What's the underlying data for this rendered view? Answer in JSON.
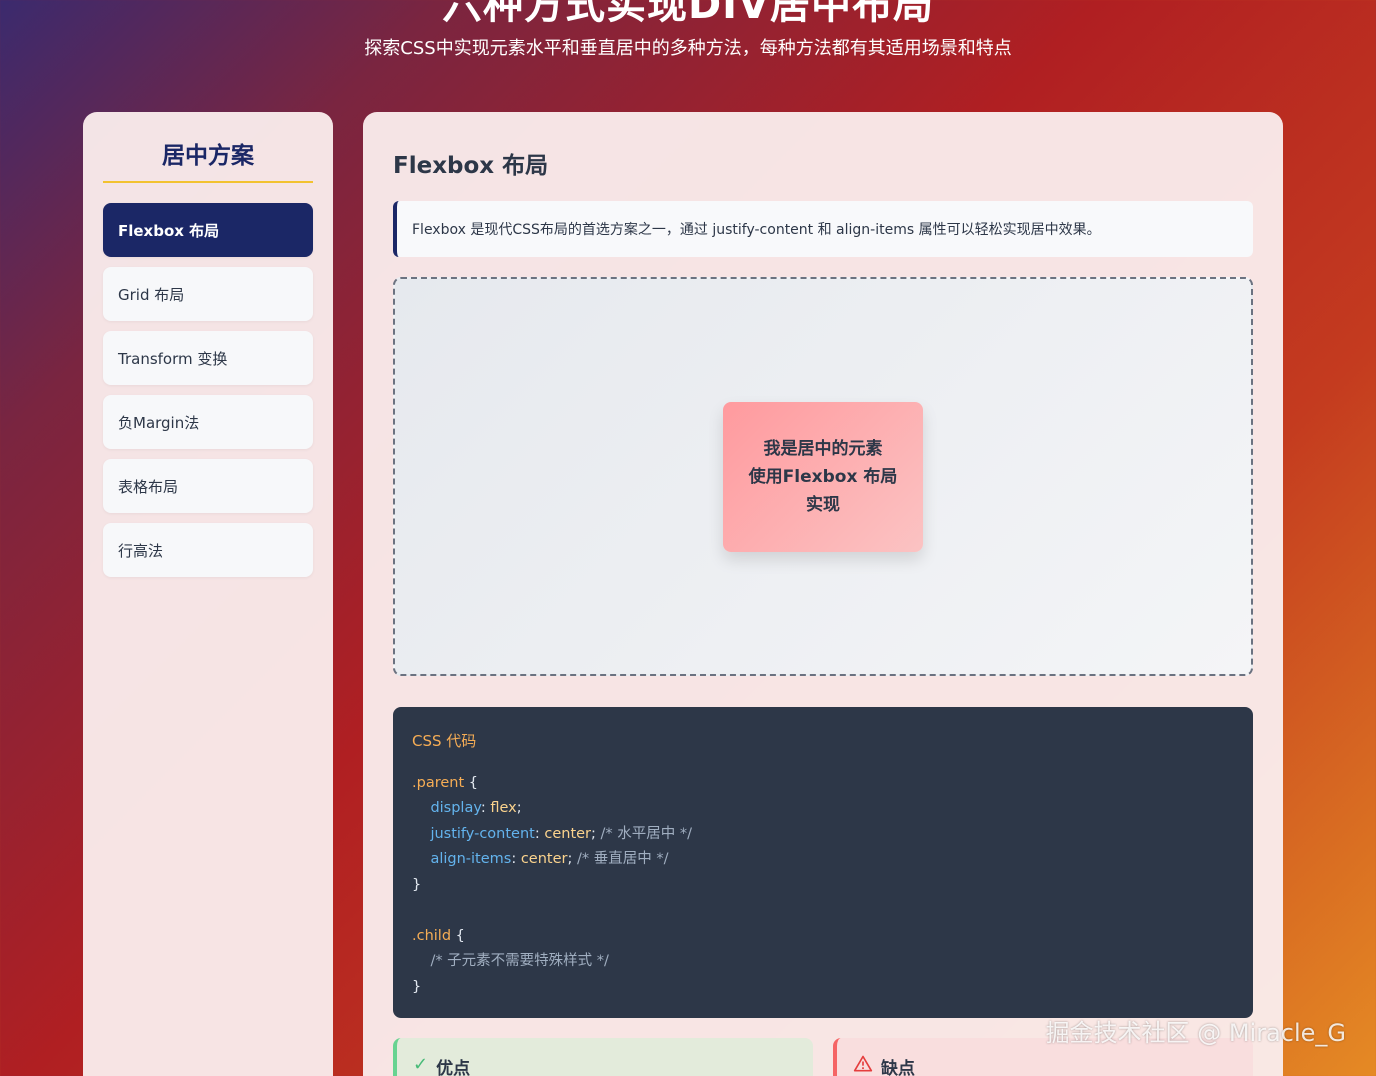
{
  "hero": {
    "title": "六种方式实现DIV居中布局",
    "subtitle": "探索CSS中实现元素水平和垂直居中的多种方法，每种方法都有其适用场景和特点"
  },
  "sidebar": {
    "title": "居中方案",
    "items": [
      {
        "label": "Flexbox 布局",
        "active": true
      },
      {
        "label": "Grid 布局"
      },
      {
        "label": "Transform 变换"
      },
      {
        "label": "负Margin法"
      },
      {
        "label": "表格布局"
      },
      {
        "label": "行高法"
      }
    ]
  },
  "main": {
    "title": "Flexbox 布局",
    "description": "Flexbox 是现代CSS布局的首选方案之一，通过 justify-content 和 align-items 属性可以轻松实现居中效果。",
    "demo": {
      "line1": "我是居中的元素",
      "line2": "使用Flexbox 布局",
      "line3": "实现"
    },
    "code": {
      "title": "CSS 代码",
      "parent_selector": ".parent",
      "open_brace": " {",
      "close_brace": "}",
      "display_prop": "display",
      "display_val": "flex",
      "justify_prop": "justify-content",
      "justify_val": "center",
      "justify_comment": "/* 水平居中 */",
      "align_prop": "align-items",
      "align_val": "center",
      "align_comment": "/* 垂直居中 */",
      "child_selector": ".child",
      "child_comment": "/* 子元素不需要特殊样式 */"
    },
    "pros_label": "优点",
    "cons_label": "缺点"
  },
  "watermark": "掘金技术社区 @ Miracle_G",
  "colors": {
    "accent_dark": "#1b2766",
    "accent_gold": "#f2c230",
    "code_bg": "#2d3748"
  }
}
